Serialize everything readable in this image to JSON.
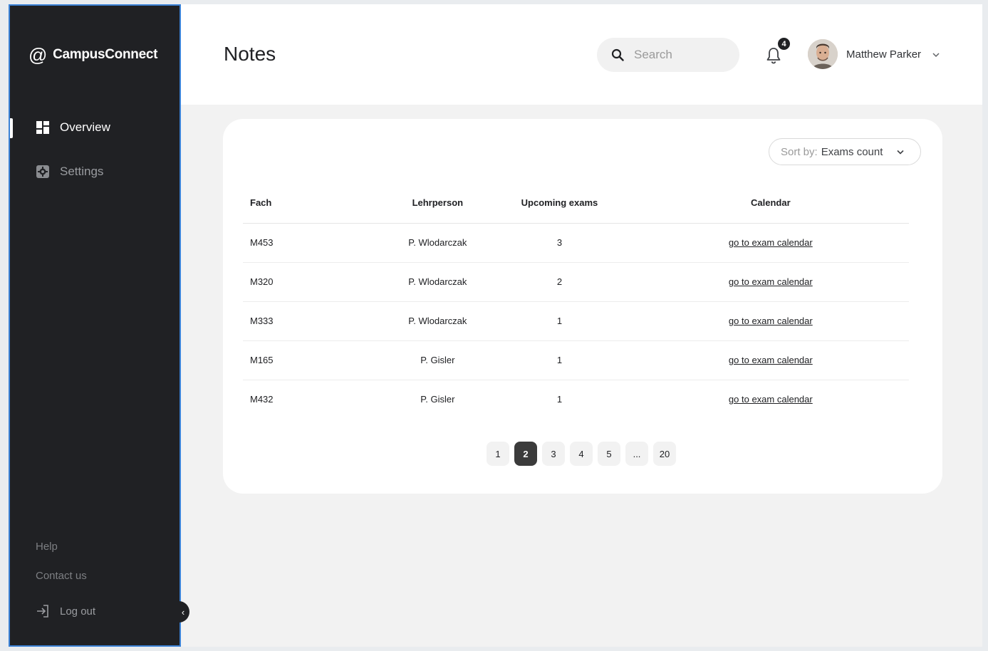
{
  "brand": {
    "at": "@",
    "name": "CampusConnect"
  },
  "sidebar": {
    "items": [
      {
        "label": "Overview",
        "icon": "dashboard-icon",
        "active": true
      },
      {
        "label": "Settings",
        "icon": "settings-icon",
        "active": false
      }
    ],
    "footer": {
      "help": "Help",
      "contact": "Contact us",
      "logout": "Log out"
    },
    "collapse_glyph": "‹"
  },
  "header": {
    "title": "Notes",
    "search_placeholder": "Search",
    "notifications_count": "4",
    "user_name": "Matthew Parker"
  },
  "sort": {
    "label": "Sort by:",
    "value": "Exams count"
  },
  "table": {
    "headers": [
      "Fach",
      "Lehrperson",
      "Upcoming exams",
      "Calendar"
    ],
    "rows": [
      {
        "fach": "M453",
        "lehrperson": "P. Wlodarczak",
        "upcoming": "3",
        "calendar": "go to exam calendar"
      },
      {
        "fach": "M320",
        "lehrperson": "P. Wlodarczak",
        "upcoming": "2",
        "calendar": "go to exam calendar"
      },
      {
        "fach": "M333",
        "lehrperson": "P. Wlodarczak",
        "upcoming": "1",
        "calendar": "go to exam calendar"
      },
      {
        "fach": "M165",
        "lehrperson": "P. Gisler",
        "upcoming": "1",
        "calendar": "go to exam calendar"
      },
      {
        "fach": "M432",
        "lehrperson": "P. Gisler",
        "upcoming": "1",
        "calendar": "go to exam calendar"
      }
    ]
  },
  "pagination": {
    "pages": [
      "1",
      "2",
      "3",
      "4",
      "5",
      "...",
      "20"
    ],
    "current": "2"
  },
  "colors": {
    "sidebar_bg": "#202124",
    "accent_border": "#3b82d6",
    "active_page": "#3b3b3b"
  }
}
